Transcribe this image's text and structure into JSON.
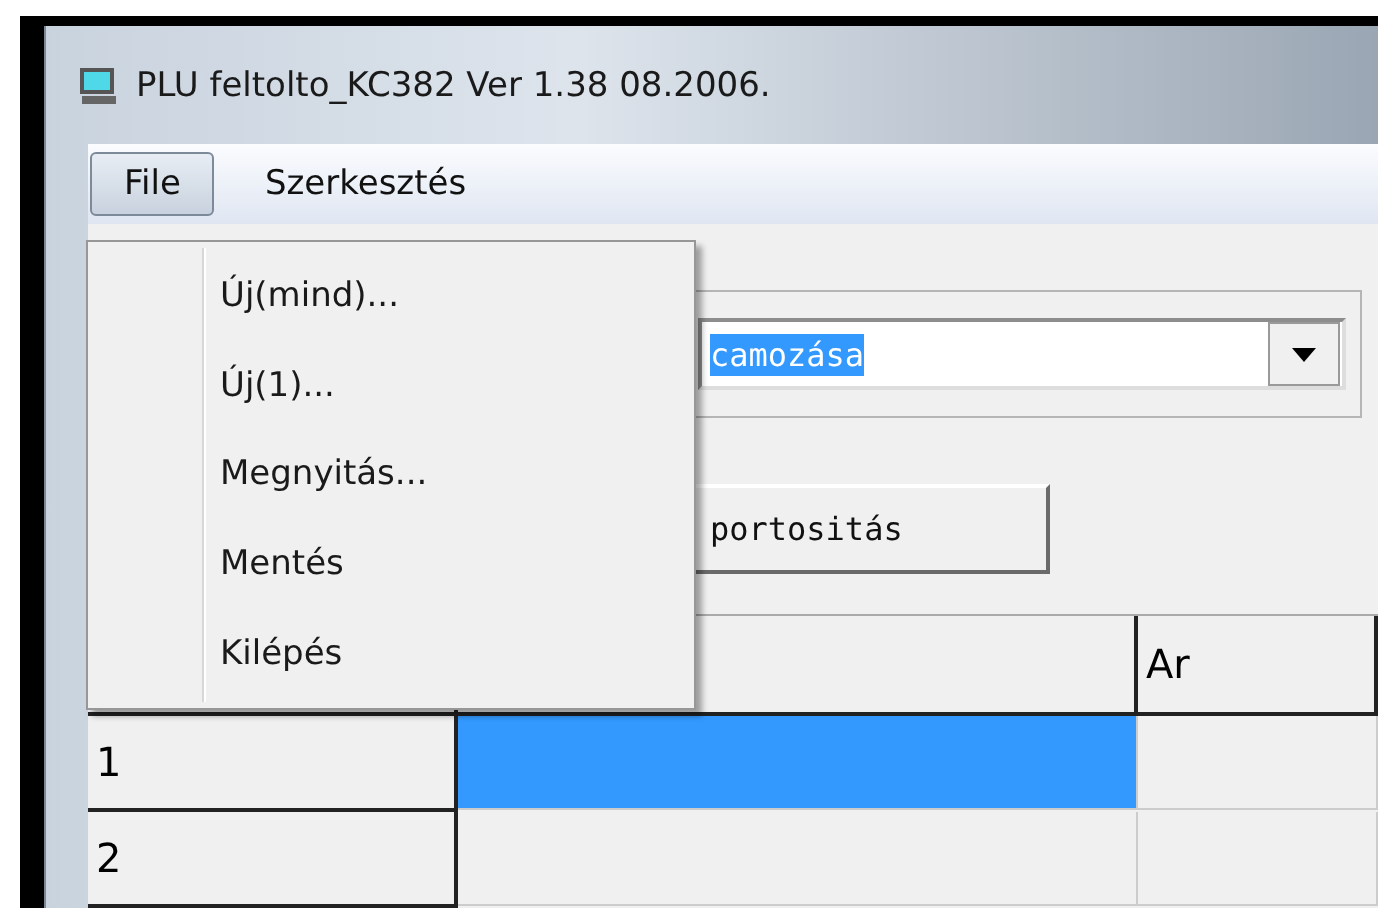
{
  "window": {
    "title": "PLU feltolto_KC382 Ver 1.38  08.2006."
  },
  "menu_bar": [
    {
      "label": "File",
      "selected": true
    },
    {
      "label": "Szerkesztés",
      "selected": false
    }
  ],
  "open_menu": {
    "items": [
      "Új(mind)...",
      "Új(1)...",
      "Megnyitás...",
      "Mentés",
      "Kilépés"
    ]
  },
  "combo": {
    "value": "camozása",
    "text_selected": true
  },
  "button": {
    "label": "portositás"
  },
  "table": {
    "columns": [
      "",
      "",
      "Ar"
    ],
    "rows": [
      {
        "header": "1",
        "selected": true
      },
      {
        "header": "2",
        "selected": false
      }
    ]
  }
}
